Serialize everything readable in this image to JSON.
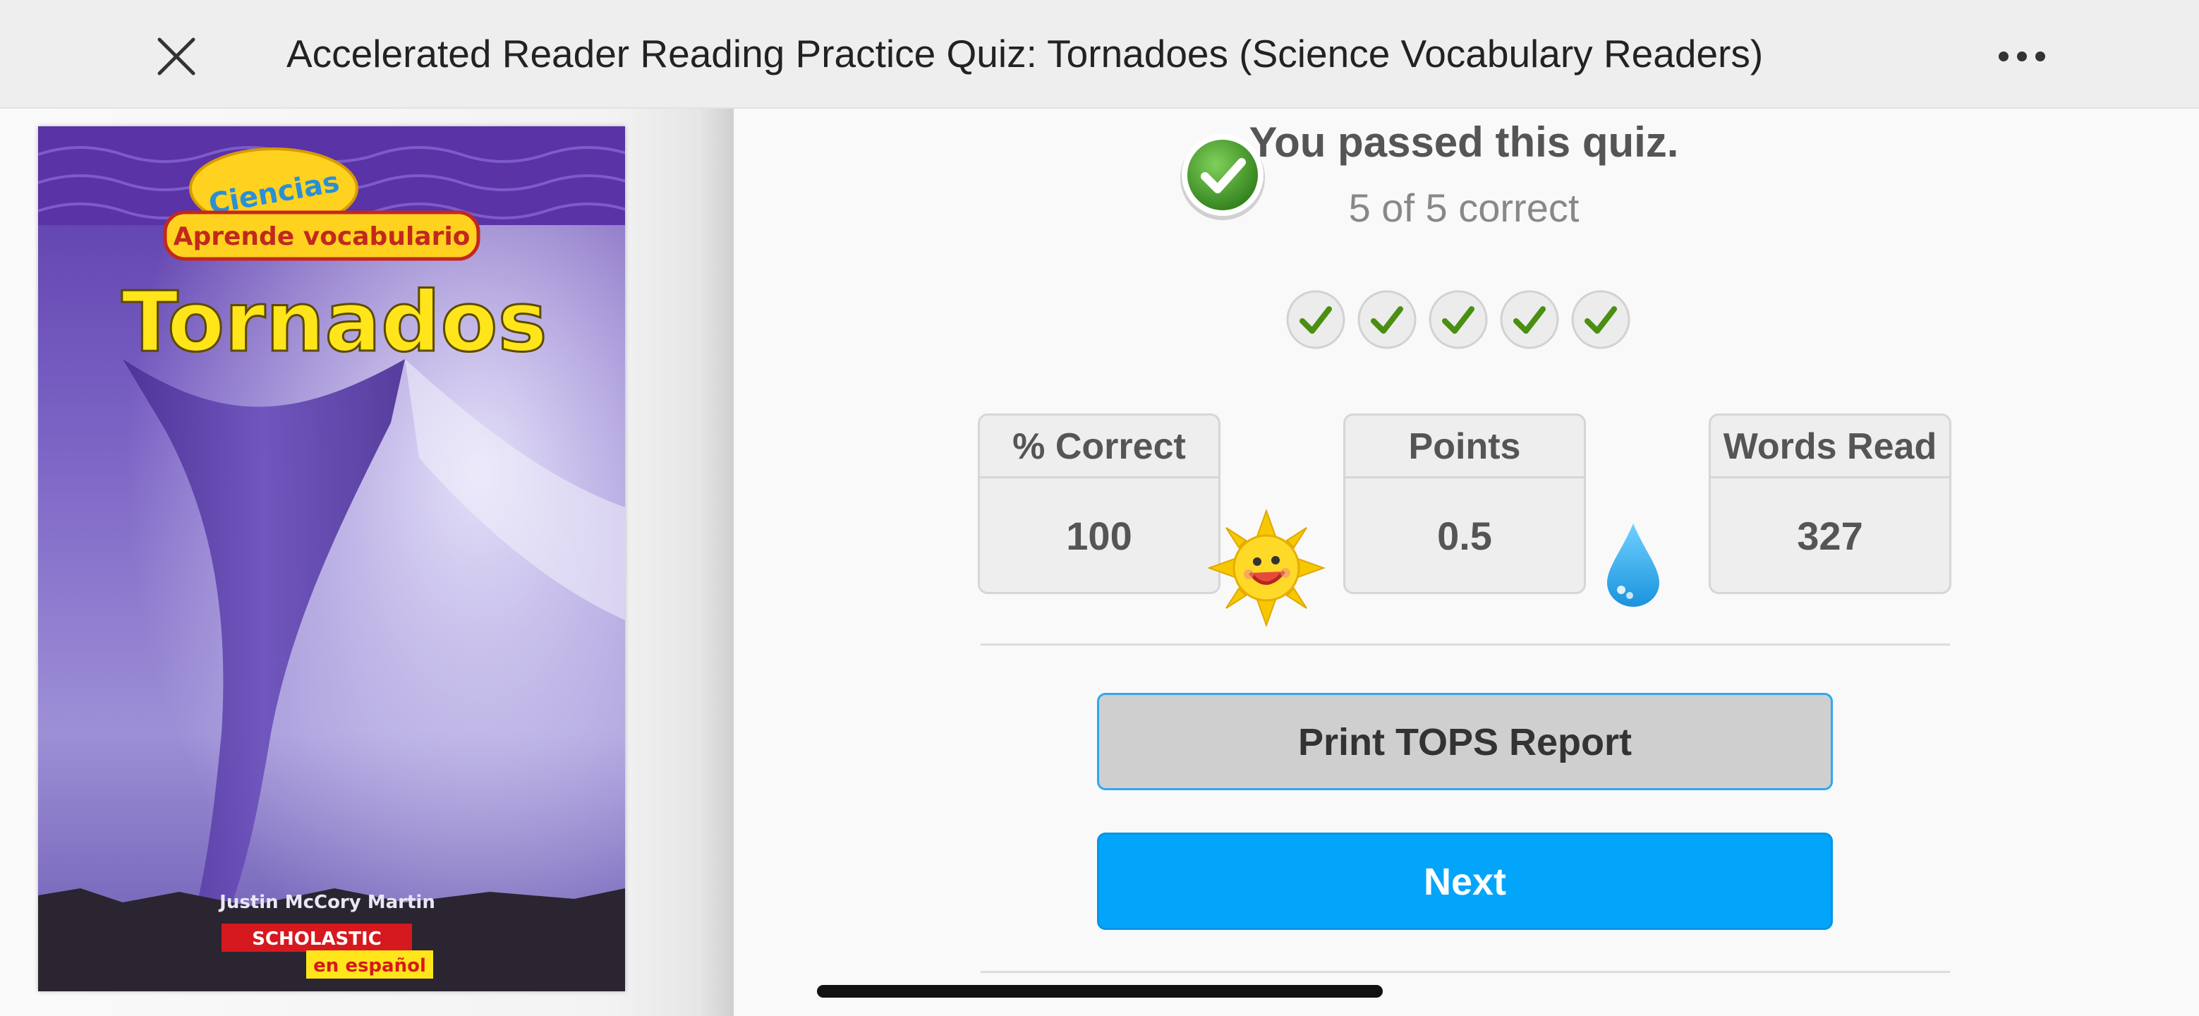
{
  "header": {
    "title": "Accelerated Reader Reading Practice Quiz: Tornadoes (Science Vocabulary Readers)",
    "close_icon": "close-icon",
    "more_icon": "more-horizontal-icon"
  },
  "book": {
    "series_top": "Ciencias",
    "series_banner": "Aprende vocabulario",
    "title": "Tornados",
    "author": "Justin McCory Martin",
    "publisher": "SCHOLASTIC",
    "edition": "en español"
  },
  "result": {
    "headline": "You passed this quiz.",
    "score_text": "5 of 5 correct",
    "question_results": [
      "correct",
      "correct",
      "correct",
      "correct",
      "correct"
    ]
  },
  "stats": [
    {
      "label": "% Correct",
      "value": "100"
    },
    {
      "label": "Points",
      "value": "0.5"
    },
    {
      "label": "Words Read",
      "value": "327"
    }
  ],
  "buttons": {
    "print": "Print TOPS Report",
    "next": "Next"
  },
  "colors": {
    "accent": "#03a5fa",
    "pass_green": "#3f9a24",
    "print_border": "#2fa8ee"
  }
}
